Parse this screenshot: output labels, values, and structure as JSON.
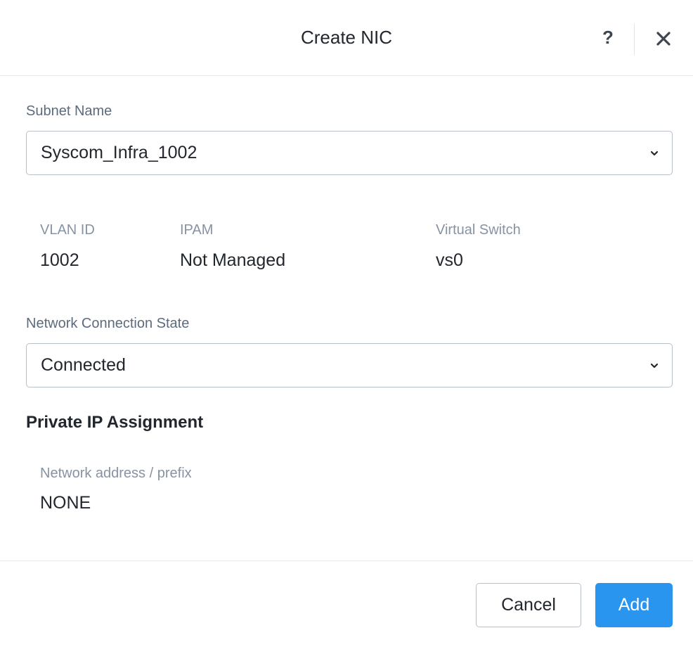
{
  "dialog": {
    "title": "Create NIC",
    "help_symbol": "?",
    "close_icon": "close-icon"
  },
  "subnet": {
    "label": "Subnet Name",
    "value": "Syscom_Infra_1002"
  },
  "subnet_info": {
    "vlan_label": "VLAN ID",
    "vlan_value": "1002",
    "ipam_label": "IPAM",
    "ipam_value": "Not Managed",
    "vswitch_label": "Virtual Switch",
    "vswitch_value": "vs0"
  },
  "connection": {
    "label": "Network Connection State",
    "value": "Connected"
  },
  "private_ip": {
    "title": "Private IP Assignment",
    "address_label": "Network address / prefix",
    "address_value": "NONE"
  },
  "footer": {
    "cancel_label": "Cancel",
    "add_label": "Add"
  },
  "colors": {
    "primary": "#2a95ef",
    "label": "#5c6b7d",
    "muted_label": "#8793a3",
    "text": "#22272e"
  }
}
